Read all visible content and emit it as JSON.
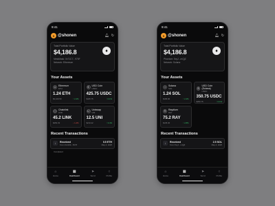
{
  "screens": [
    {
      "status_time": "9:41",
      "username": "@shonen",
      "avatar_letter": "S",
      "portfolio": {
        "label": "Total Portfolio Value",
        "value": "$4,186.8",
        "address": "MetaMask: 0x71C7...976F",
        "network": "Network: Ethereum",
        "badge": "♦"
      },
      "assets_title": "Your Assets",
      "assets": [
        {
          "name": "Ethereum",
          "symbol": "ETH",
          "glyph": "♦",
          "amount": "1.24 ETH",
          "usd": "$3,100.50",
          "change": "↑ 2.4%",
          "direction": "up"
        },
        {
          "name": "USD Coin",
          "symbol": "USDC",
          "glyph": "$",
          "amount": "425.75 USDC",
          "usd": "$425.75",
          "change": "↑ 0.1%",
          "direction": "up"
        },
        {
          "name": "Chainlink",
          "symbol": "LINK",
          "glyph": "⬡",
          "amount": "45.2 LINK",
          "usd": "$450.33",
          "change": "↓ 1.2%",
          "direction": "down"
        },
        {
          "name": "Uniswap",
          "symbol": "UNI",
          "glyph": "U",
          "amount": "12.5 UNI",
          "usd": "$210.22",
          "change": "↑ 3.4%",
          "direction": "up"
        }
      ],
      "transactions_title": "Recent Transactions",
      "transaction": {
        "title": "Received",
        "from": "From 0x1234...5678",
        "amount": "0.5 ETH",
        "date": "May 4, 2025",
        "glyph": "↓"
      },
      "transaction_status": "Completed",
      "tabs": [
        {
          "label": "Home",
          "glyph": "⌂",
          "active": false
        },
        {
          "label": "Dashboard",
          "glyph": "▦",
          "active": true
        },
        {
          "label": "Send",
          "glyph": "➤",
          "active": false
        },
        {
          "label": "Profile",
          "glyph": "○",
          "active": false
        }
      ]
    },
    {
      "status_time": "9:41",
      "username": "@shonen",
      "avatar_letter": "S",
      "portfolio": {
        "label": "Total Portfolio Value",
        "value": "$4,186.8",
        "address": "Phantom: 5xyJ...mQjZ",
        "network": "Network: Solana",
        "badge": "♦"
      },
      "assets_title": "Your Assets",
      "assets": [
        {
          "name": "Solana",
          "symbol": "SOL",
          "glyph": "≡",
          "amount": "1.24 SOL",
          "usd": "$186.00",
          "change": "↑ 2.4%",
          "direction": "up"
        },
        {
          "name": "USD Coin (Solana)",
          "symbol": "USDC",
          "glyph": "$",
          "amount": "350.75 USDC",
          "usd": "$350.75",
          "change": "↑ 0.1%",
          "direction": "up"
        },
        {
          "name": "Raydium",
          "symbol": "RAY",
          "glyph": "R",
          "amount": "75.2 RAY",
          "usd": "$135.36",
          "change": "↑ 2.8%",
          "direction": "up"
        }
      ],
      "transactions_title": "Recent Transactions",
      "transaction": {
        "title": "Received",
        "from": "From 5xyJ...mQjZ",
        "amount": "2.5 SOL",
        "date": "May 4, 2025",
        "glyph": "↓"
      },
      "transaction_status": "",
      "tabs": [
        {
          "label": "Home",
          "glyph": "⌂",
          "active": false
        },
        {
          "label": "Dashboard",
          "glyph": "▦",
          "active": true
        },
        {
          "label": "Send",
          "glyph": "➤",
          "active": false
        },
        {
          "label": "Profile",
          "glyph": "○",
          "active": false
        }
      ]
    }
  ]
}
